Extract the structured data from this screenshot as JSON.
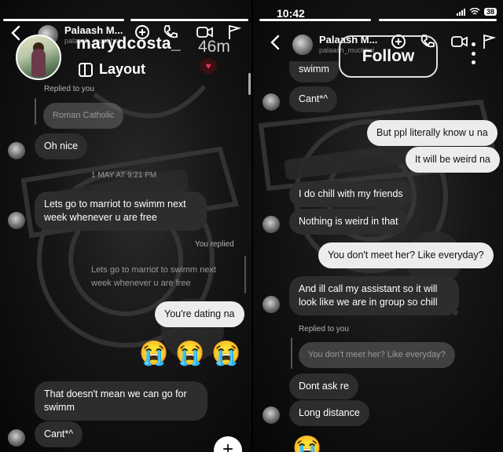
{
  "left": {
    "header": {
      "name": "Palaash M...",
      "username": "palaash_muchhal"
    },
    "story": {
      "username": "marydcosta_",
      "age": "46m",
      "layout_label": "Layout",
      "heart": "♥"
    },
    "messages": {
      "replied_label": "Replied to you",
      "quoted_roman": "Roman Catholic",
      "oh_nice": "Oh nice",
      "date_sep": "1 MAY AT 9:21 PM",
      "lets_go": "Lets go to marriot to swimm next week whenever u are free",
      "you_replied": "You replied",
      "quoted_lets_go": "Lets go to marriot to swimm next week whenever u are free",
      "dating": "You're dating na",
      "emojis": [
        "😭",
        "😭",
        "😭"
      ],
      "doesnt_mean": "That doesn't mean we can go for swimm",
      "cant": "Cant*^"
    },
    "plus": "+"
  },
  "right": {
    "status": {
      "time": "10:42",
      "battery": "38"
    },
    "header": {
      "name": "Palaash M...",
      "username": "palaash_muchhal"
    },
    "follow_label": "Follow",
    "messages": {
      "swimm_partial": "swimm",
      "cant": "Cant*^",
      "ppl_know": "But ppl literally know u na",
      "weird": "It will be weird na",
      "chill_friends": "I do chill with my friends",
      "nothing_weird": "Nothing is weird in that",
      "dont_meet": "You don't meet her? Like everyday?",
      "assistant": "And ill call my assistant so it will look like we are in group so chill",
      "replied_label": "Replied to you",
      "quoted_dont_meet": "You don't meet her? Like everyday?",
      "dont_ask": "Dont ask re",
      "long_distance": "Long distance",
      "bottom_emoji": "😭"
    }
  },
  "icons": [
    "back-chevron-icon",
    "verified-badge-icon",
    "add-user-icon",
    "phone-icon",
    "video-icon",
    "flag-icon"
  ]
}
